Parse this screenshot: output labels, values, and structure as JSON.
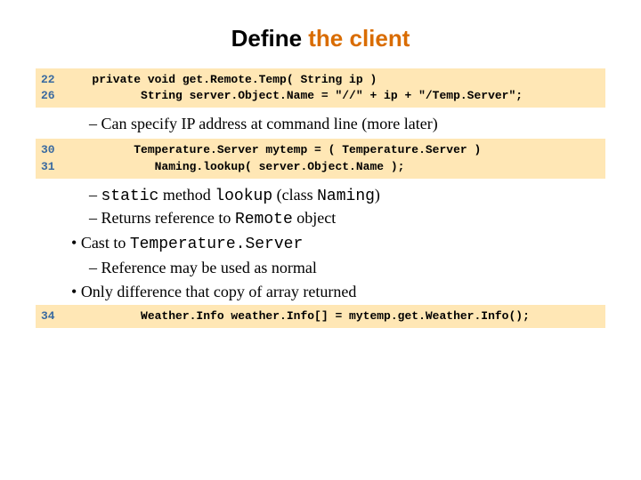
{
  "title": {
    "black": "Define ",
    "orange": "the client"
  },
  "code1": {
    "lines": [
      {
        "no": "22",
        "text": "   private void get.Remote.Temp( String ip )"
      },
      {
        "no": "26",
        "text": "          String server.Object.Name = \"//\" + ip + \"/Temp.Server\";"
      }
    ]
  },
  "bullet1": "Can specify IP address at command line (more later)",
  "code2": {
    "lines": [
      {
        "no": "30",
        "text": "         Temperature.Server mytemp = ( Temperature.Server )"
      },
      {
        "no": "31",
        "text": "            Naming.lookup( server.Object.Name );"
      }
    ]
  },
  "bullet2": {
    "pre": "",
    "w1": "static",
    "mid1": " method ",
    "w2": "lookup",
    "mid2": " (class ",
    "w3": "Naming",
    "post": ")"
  },
  "bullet3": {
    "pre": "Returns reference to ",
    "w1": "Remote",
    "post": " object"
  },
  "sub3a": {
    "pre": "Cast to ",
    "w1": "Temperature.Server"
  },
  "bullet4": "Reference may be used as normal",
  "sub4a": "Only difference that copy of array returned",
  "code3": {
    "lines": [
      {
        "no": "34",
        "text": "          Weather.Info weather.Info[] = mytemp.get.Weather.Info();"
      }
    ]
  }
}
